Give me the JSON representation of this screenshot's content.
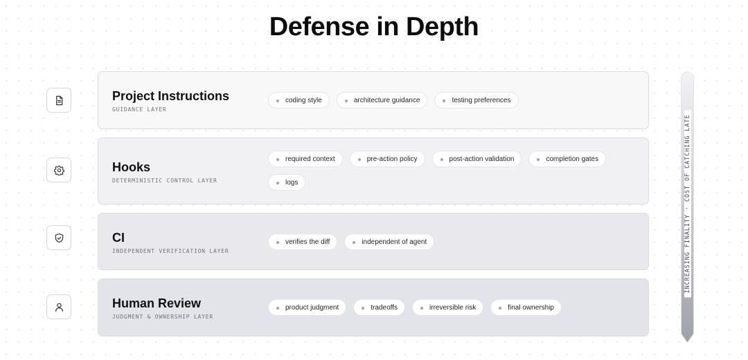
{
  "title": "Defense in Depth",
  "layers": [
    {
      "name": "Project Instructions",
      "sublabel": "GUIDANCE LAYER",
      "icon": "document-icon",
      "background": "#f8f8f9",
      "chips": [
        "coding style",
        "architecture guidance",
        "testing preferences"
      ]
    },
    {
      "name": "Hooks",
      "sublabel": "DETERMINISTIC CONTROL LAYER",
      "icon": "gear-icon",
      "background": "#f1f1f3",
      "chips": [
        "required context",
        "pre-action policy",
        "post-action validation",
        "completion gates",
        "logs"
      ]
    },
    {
      "name": "CI",
      "sublabel": "INDEPENDENT VERIFICATION LAYER",
      "icon": "shield-check-icon",
      "background": "#e9e9ed",
      "chips": [
        "verifies the diff",
        "independent of agent"
      ]
    },
    {
      "name": "Human Review",
      "sublabel": "JUDGMENT & OWNERSHIP LAYER",
      "icon": "user-icon",
      "background": "#e2e4ea",
      "chips": [
        "product judgment",
        "tradeoffs",
        "irreversible risk",
        "final ownership"
      ]
    }
  ],
  "axis": {
    "label": "INCREASING FINALITY · COST OF CATCHING LATE",
    "gradient_start": "#f3f3f5",
    "gradient_end": "#9fa1a8"
  }
}
